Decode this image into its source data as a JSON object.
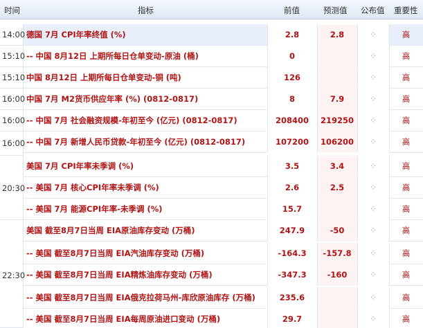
{
  "header": {
    "time": "时间",
    "indicator": "指标",
    "previous": "前值",
    "forecast": "预测值",
    "published": "公布值",
    "importance": "重要性"
  },
  "pub_icon": "loading-spinner-icon",
  "rows": [
    {
      "indicator": "德国 7月 CPI年率终值 (%)",
      "previous": "2.8",
      "forecast": "2.8",
      "importance": "高"
    },
    {
      "indicator": "-- 中国 8月12日 上期所每日仓单变动-原油 (桶)",
      "previous": "0",
      "forecast": "",
      "importance": "高"
    },
    {
      "indicator": "中国 8月12日 上期所每日仓单变动-铜 (吨)",
      "previous": "126",
      "forecast": "",
      "importance": "高"
    },
    {
      "indicator": "中国 7月 M2货币供应年率 (%) (0812-0817)",
      "previous": "8",
      "forecast": "7.9",
      "importance": "高"
    },
    {
      "indicator": "-- 中国 7月 社会融资规模-年初至今 (亿元) (0812-0817)",
      "previous": "208400",
      "forecast": "219250",
      "importance": "高"
    },
    {
      "indicator": "-- 中国 7月 新增人民币贷款-年初至今 (亿元) (0812-0817)",
      "previous": "107200",
      "forecast": "106200",
      "importance": "高"
    },
    {
      "indicator": "美国 7月 CPI年率未季调 (%)",
      "previous": "3.5",
      "forecast": "3.4",
      "importance": "高"
    },
    {
      "indicator": "-- 美国 7月 核心CPI年率未季调 (%)",
      "previous": "2.6",
      "forecast": "2.5",
      "importance": "高"
    },
    {
      "indicator": "-- 美国 7月 能源CPI年率-未季调 (%)",
      "previous": "15.7",
      "forecast": "",
      "importance": "高"
    },
    {
      "indicator": "美国 截至8月7日当周 EIA原油库存变动 (万桶)",
      "previous": "247.9",
      "forecast": "-50",
      "importance": "高"
    },
    {
      "indicator": "-- 美国 截至8月7日当周 EIA汽油库存变动 (万桶)",
      "previous": "-164.3",
      "forecast": "-157.8",
      "importance": "高"
    },
    {
      "indicator": "-- 美国 截至8月7日当周 EIA精炼油库存变动 (万桶)",
      "previous": "-347.3",
      "forecast": "-160",
      "importance": "高"
    },
    {
      "indicator": "-- 美国 截至8月7日当周 EIA俄克拉荷马州-库欣原油库存 (万桶)",
      "previous": "235.6",
      "forecast": "",
      "importance": "高"
    },
    {
      "indicator": "-- 美国 截至8月7日当周 EIA每周原油进口变动 (万桶)",
      "previous": "29.7",
      "forecast": "",
      "importance": "高"
    }
  ],
  "times": [
    "14:00",
    "15:10",
    "15:10",
    "16:00",
    "16:00",
    "16:00",
    "20:30",
    "22:30"
  ]
}
